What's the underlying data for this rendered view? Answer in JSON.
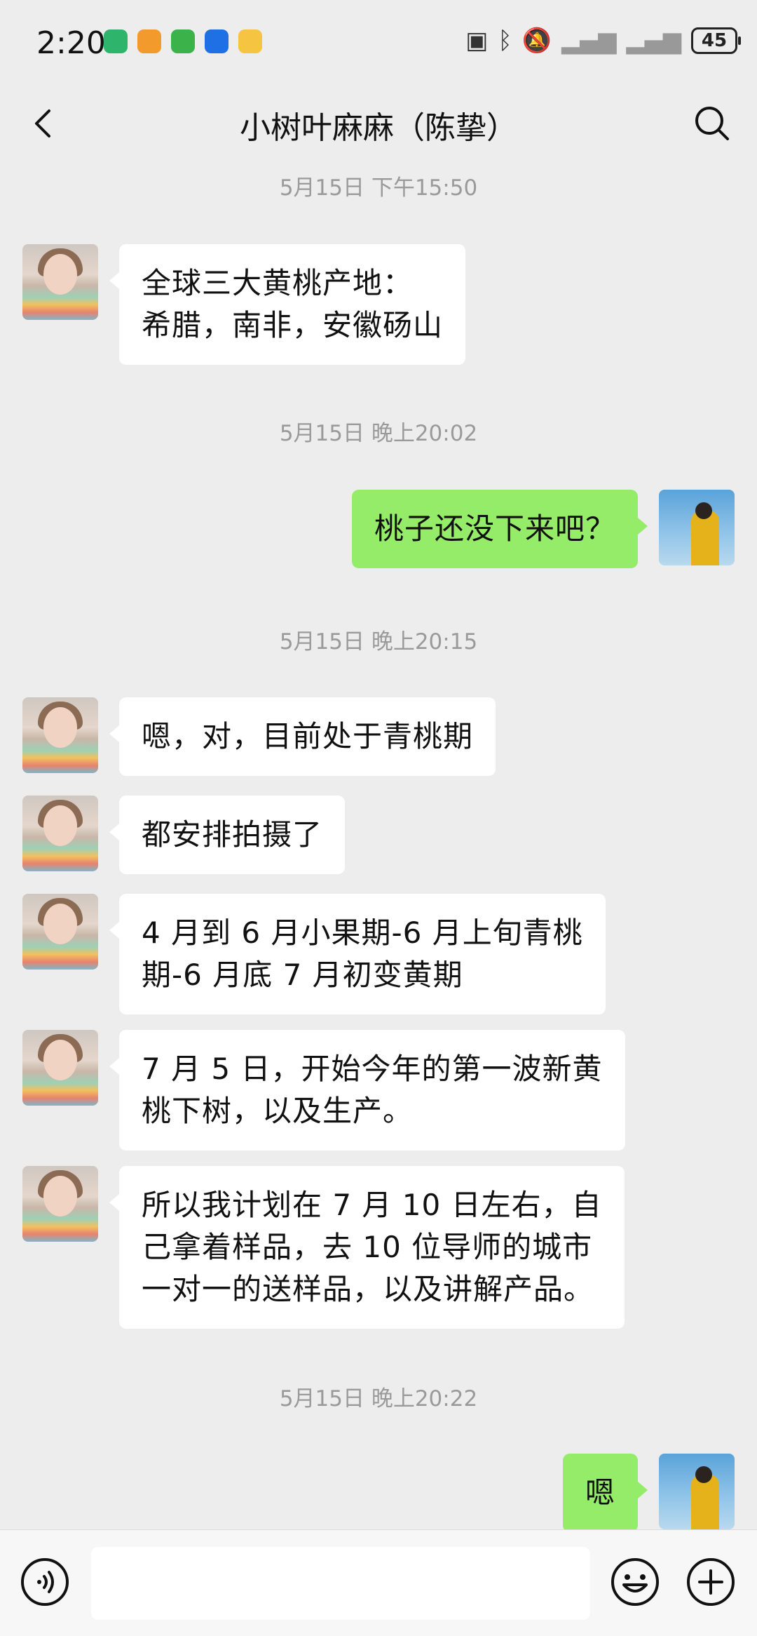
{
  "status_bar": {
    "time": "2:20",
    "battery": "45",
    "app_icons": [
      {
        "name": "app-icon-1",
        "color": "#2fb46c"
      },
      {
        "name": "app-icon-2",
        "color": "#f39a2c"
      },
      {
        "name": "app-icon-3",
        "color": "#3cb34a"
      },
      {
        "name": "app-icon-4",
        "color": "#1f6fe5"
      },
      {
        "name": "app-icon-5",
        "color": "#f5c542"
      }
    ]
  },
  "header": {
    "title": "小树叶麻麻（陈挚）",
    "back_icon": "chevron-left-icon",
    "search_icon": "search-icon"
  },
  "colors": {
    "background": "#ededed",
    "outgoing_bubble": "#95ec69",
    "incoming_bubble": "#ffffff",
    "timestamp": "#9a9a9a"
  },
  "messages": [
    {
      "type": "timestamp",
      "text": "5月15日 下午15:50"
    },
    {
      "type": "incoming",
      "text": "全球三大黄桃产地：\n希腊，南非，安徽砀山"
    },
    {
      "type": "timestamp",
      "text": "5月15日 晚上20:02"
    },
    {
      "type": "outgoing",
      "text": "桃子还没下来吧？"
    },
    {
      "type": "timestamp",
      "text": "5月15日 晚上20:15"
    },
    {
      "type": "incoming",
      "text": "嗯，对，目前处于青桃期"
    },
    {
      "type": "incoming",
      "text": "都安排拍摄了"
    },
    {
      "type": "incoming",
      "text": "4 月到 6 月小果期-6 月上旬青桃\n期-6 月底 7 月初变黄期"
    },
    {
      "type": "incoming",
      "text": "7 月 5 日，开始今年的第一波新黄\n桃下树，以及生产。"
    },
    {
      "type": "incoming",
      "text": "所以我计划在 7 月 10 日左右，自\n己拿着样品，去 10 位导师的城市\n一对一的送样品，以及讲解产品。"
    },
    {
      "type": "timestamp",
      "text": "5月15日 晚上20:22"
    },
    {
      "type": "outgoing",
      "text": "嗯"
    }
  ],
  "input_bar": {
    "voice_icon": "voice-icon",
    "emoji_icon": "emoji-icon",
    "plus_icon": "plus-icon",
    "placeholder": ""
  }
}
